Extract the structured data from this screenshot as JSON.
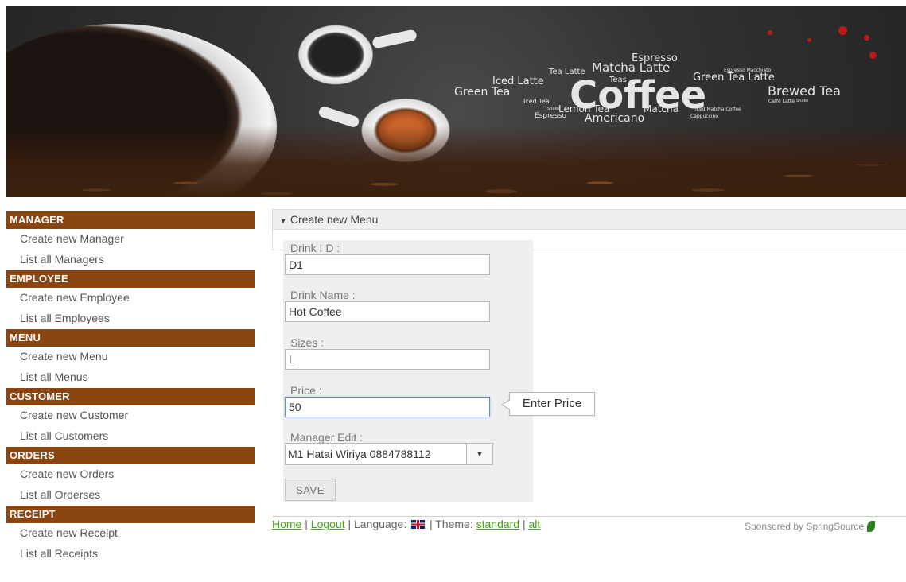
{
  "banner": {
    "brand_word": "Coffee",
    "words": [
      "Espresso",
      "Tea Latte",
      "Matcha Latte",
      "Espresso Macchiato",
      "Iced Latte",
      "Teas",
      "Green Tea Latte",
      "Green Tea",
      "Brewed Tea",
      "Iced Tea",
      "Caffè Latte",
      "Shake",
      "Shake",
      "Lemon Tea",
      "Matcha",
      "Iced Matcha Coffee",
      "Espresso",
      "Americano",
      "Cappuccino"
    ]
  },
  "sidebar": {
    "sections": [
      {
        "title": "MANAGER",
        "links": [
          "Create new Manager",
          "List all Managers"
        ]
      },
      {
        "title": "EMPLOYEE",
        "links": [
          "Create new Employee",
          "List all Employees"
        ]
      },
      {
        "title": "MENU",
        "links": [
          "Create new Menu",
          "List all Menus"
        ]
      },
      {
        "title": "CUSTOMER",
        "links": [
          "Create new Customer",
          "List all Customers"
        ]
      },
      {
        "title": "ORDERS",
        "links": [
          "Create new Orders",
          "List all Orderses"
        ]
      },
      {
        "title": "RECEIPT",
        "links": [
          "Create new Receipt",
          "List all Receipts"
        ]
      }
    ]
  },
  "panel": {
    "title": "Create new Menu"
  },
  "form": {
    "drink_id": {
      "label": "Drink I D :",
      "value": "D1"
    },
    "drink_name": {
      "label": "Drink Name :",
      "value": "Hot Coffee"
    },
    "sizes": {
      "label": "Sizes :",
      "value": "L"
    },
    "price": {
      "label": "Price :",
      "value": "50",
      "tooltip": "Enter Price"
    },
    "manager_edit": {
      "label": "Manager Edit :",
      "selected": "M1 Hatai Wiriya 0884788112"
    },
    "save_label": "SAVE"
  },
  "footer": {
    "home": "Home",
    "sep1": " | ",
    "logout": "Logout",
    "language_label": " | Language: ",
    "theme_label": " | Theme: ",
    "theme_standard": "standard",
    "sep2": " | ",
    "theme_alt": "alt",
    "sponsor": "Sponsored by SpringSource"
  },
  "colors": {
    "sidebar_header": "#8a4512",
    "link_green": "#45a018",
    "focus_border": "#6a8fc8"
  },
  "icons": {
    "panel_toggle": "triangle-down-icon",
    "select_arrow": "caret-down-icon",
    "language_flag": "uk-flag-icon",
    "sponsor_logo": "springsource-leaf-icon"
  }
}
